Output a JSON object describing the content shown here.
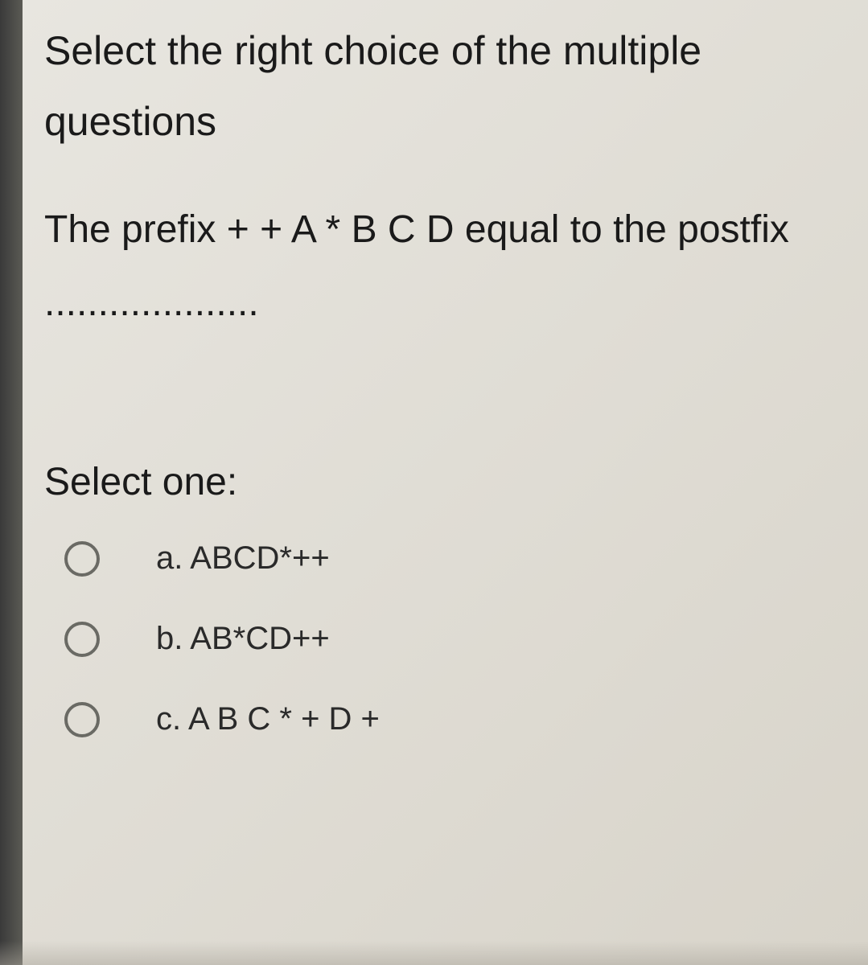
{
  "instruction": "Select the right choice of the multiple questions",
  "question": "The prefix + + A * B C D equal to the postfix ....................",
  "select_label": "Select one:",
  "options": [
    {
      "label": "a. ABCD*++"
    },
    {
      "label": "b. AB*CD++"
    },
    {
      "label": "c. A B C * + D +"
    }
  ]
}
